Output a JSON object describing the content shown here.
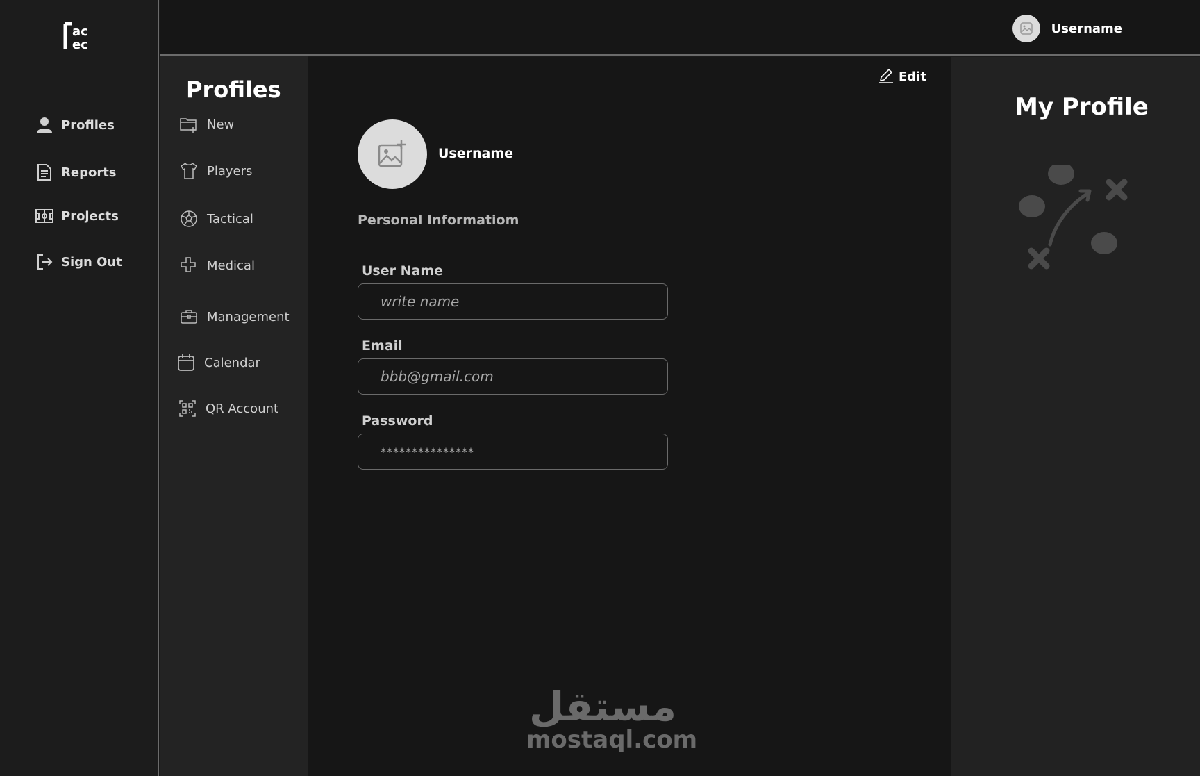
{
  "brand": {
    "logo_text": "ac ec"
  },
  "left_nav": {
    "items": [
      {
        "label": "Profiles",
        "icon": "user-icon"
      },
      {
        "label": "Reports",
        "icon": "document-icon"
      },
      {
        "label": "Projects",
        "icon": "field-icon"
      },
      {
        "label": "Sign Out",
        "icon": "sign-out-icon"
      }
    ]
  },
  "topbar": {
    "username": "Username"
  },
  "sub_nav": {
    "title": "Profiles",
    "items": [
      {
        "label": "New",
        "icon": "folder-plus-icon"
      },
      {
        "label": "Players",
        "icon": "shirt-icon"
      },
      {
        "label": "Tactical",
        "icon": "ball-icon"
      },
      {
        "label": "Medical",
        "icon": "medical-cross-icon"
      },
      {
        "label": "Management",
        "icon": "briefcase-icon"
      },
      {
        "label": "Calendar",
        "icon": "calendar-icon"
      },
      {
        "label": "QR Account",
        "icon": "qr-icon"
      }
    ]
  },
  "main": {
    "edit_label": "Edit",
    "username": "Username",
    "section_title": "Personal Informatiom",
    "fields": {
      "username": {
        "label": "User Name",
        "placeholder": "write name"
      },
      "email": {
        "label": "Email",
        "placeholder": "bbb@gmail.com"
      },
      "password": {
        "label": "Password",
        "placeholder": "***************"
      }
    },
    "watermark": {
      "arabic": "مستقل",
      "latin": "mostaql.com"
    }
  },
  "right_panel": {
    "title": "My Profile"
  },
  "colors": {
    "background": "#161616",
    "sidebar": "#1c1c1c",
    "subnav": "#232323",
    "panel": "#222222",
    "border": "#6b6b6b"
  }
}
